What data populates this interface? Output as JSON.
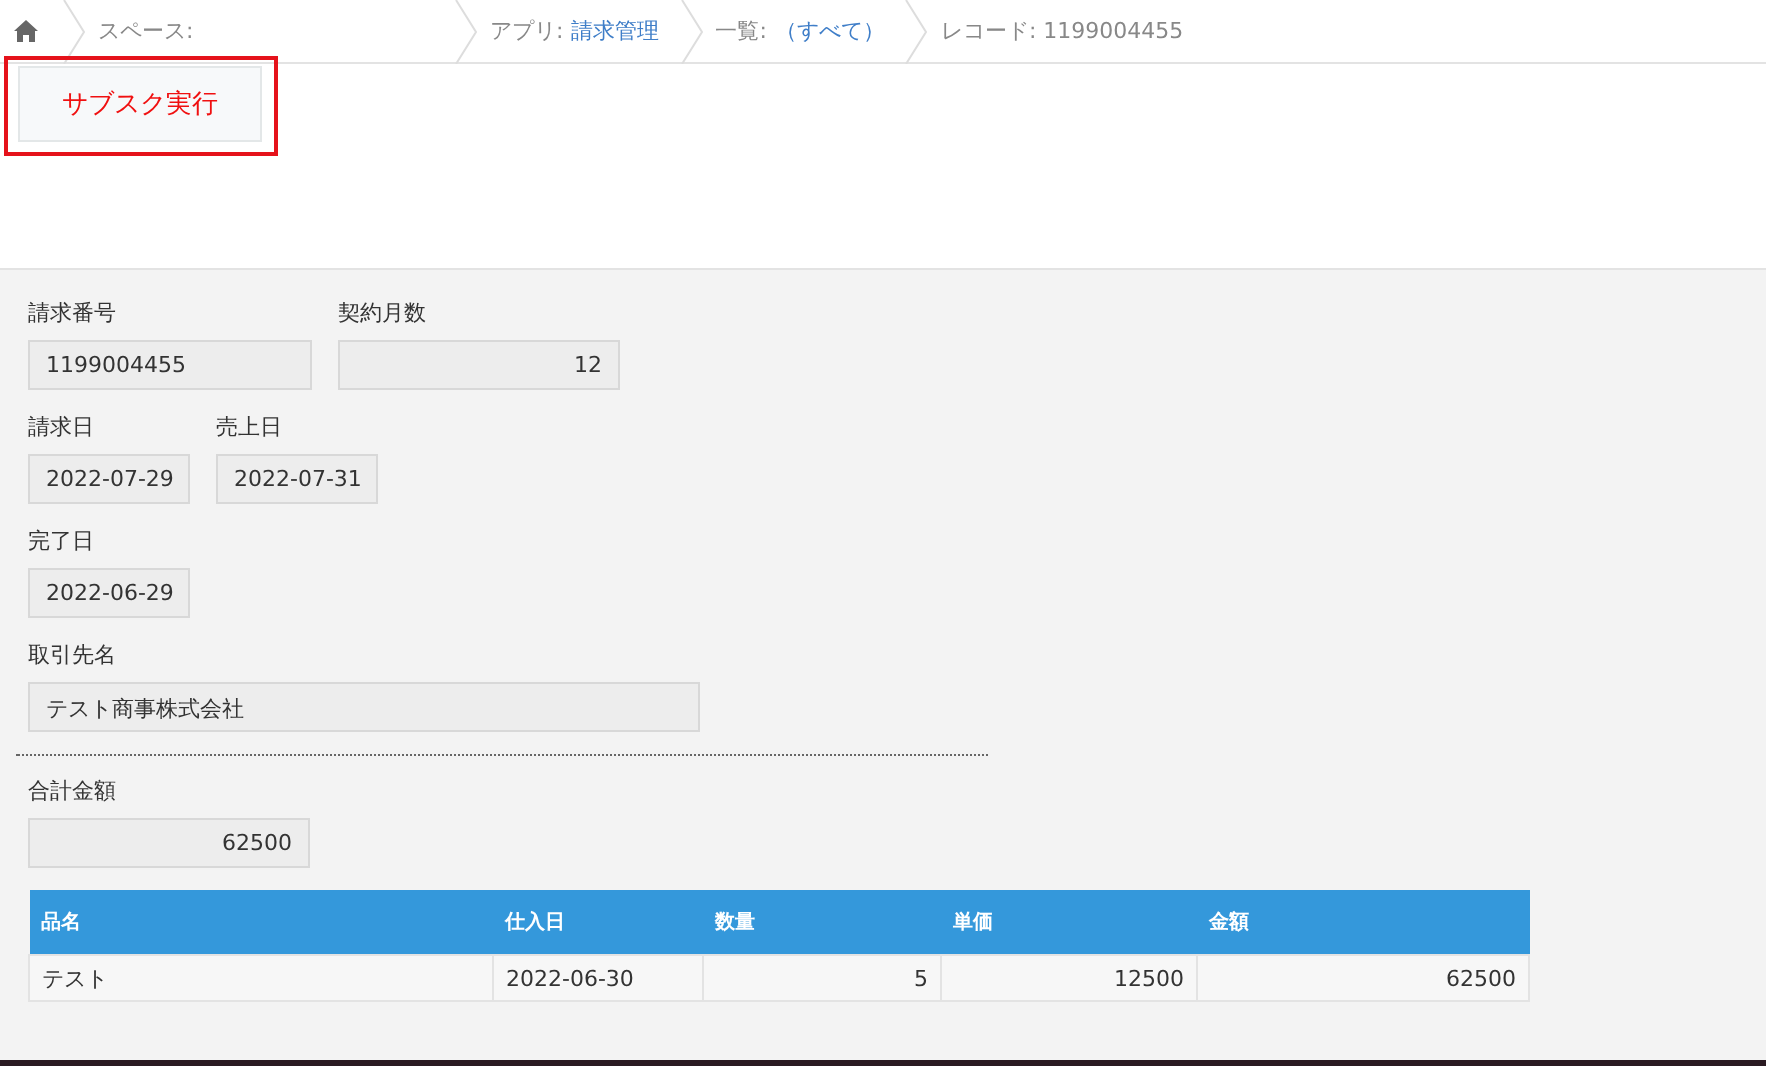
{
  "breadcrumb": [
    {
      "label": "スペース:"
    },
    {
      "label": "アプリ:",
      "link": "請求管理"
    },
    {
      "label": "一覧:",
      "link": "（すべて）"
    },
    {
      "label": "レコード: 1199004455"
    }
  ],
  "action_button": {
    "label": "サブスク実行",
    "highlighted": true
  },
  "field_rows": [
    [
      {
        "label": "請求番号",
        "value": "1199004455",
        "kind": "text"
      },
      {
        "label": "契約月数",
        "value": "12",
        "kind": "number"
      }
    ],
    [
      {
        "label": "請求日",
        "value": "2022-07-29",
        "kind": "date"
      },
      {
        "label": "売上日",
        "value": "2022-07-31",
        "kind": "date"
      }
    ],
    [
      {
        "label": "完了日",
        "value": "2022-06-29",
        "kind": "date"
      }
    ],
    [
      {
        "label": "取引先名",
        "value": "テスト商事株式会社",
        "kind": "wide"
      }
    ]
  ],
  "total_rows": [
    [
      {
        "label": "合計金額",
        "value": "62500",
        "kind": "number"
      }
    ]
  ],
  "table": {
    "columns": [
      "品名",
      "仕入日",
      "数量",
      "単価",
      "金額"
    ],
    "rows": [
      [
        "テスト",
        "2022-06-30",
        "5",
        "12500",
        "62500"
      ]
    ]
  }
}
